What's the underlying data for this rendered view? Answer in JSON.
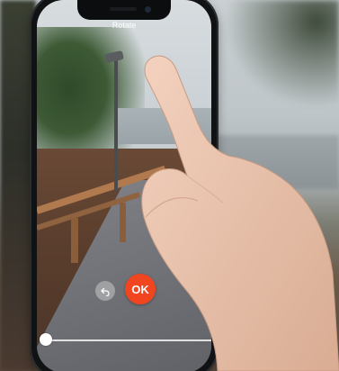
{
  "app": {
    "title": "Rotate"
  },
  "controls": {
    "undo_icon": "undo-icon",
    "ok_label": "OK"
  },
  "slider": {
    "value": 0
  },
  "colors": {
    "ok_button": "#f0451e",
    "title_text": "#ffffff"
  }
}
